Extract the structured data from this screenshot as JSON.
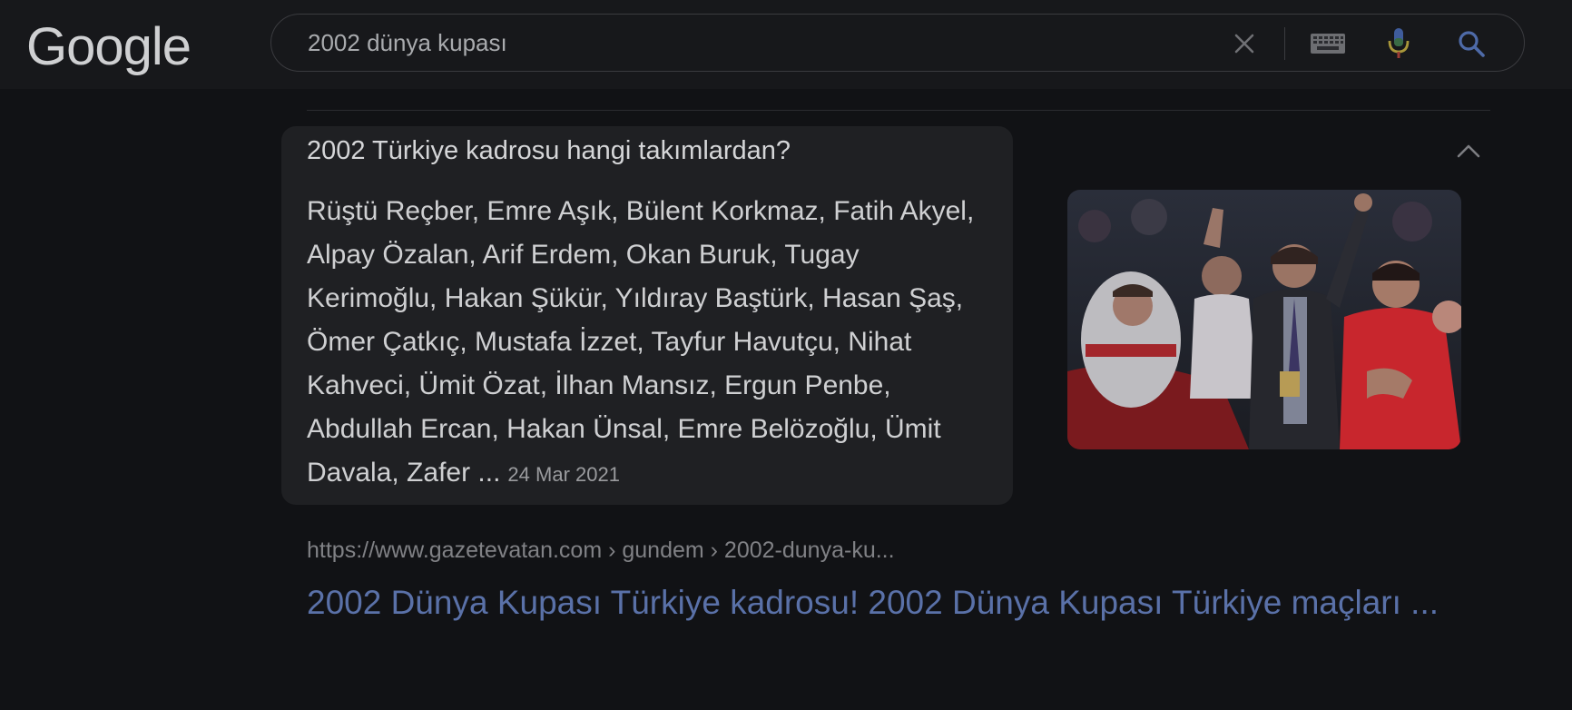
{
  "header": {
    "logo_text": "Google",
    "search": {
      "query": "2002 dünya kupası"
    },
    "icons": {
      "clear": "close-icon",
      "keyboard": "keyboard-icon",
      "mic": "microphone-icon",
      "search": "search-icon"
    }
  },
  "featured_snippet": {
    "question": "2002 Türkiye kadrosu hangi takımlardan?",
    "answer": "Rüştü Reçber, Emre Aşık, Bülent Korkmaz, Fatih Akyel, Alpay Özalan, Arif Erdem, Okan Buruk, Tugay Kerimoğlu, Hakan Şükür, Yıldıray Baştürk, Hasan Şaş, Ömer Çatkıç, Mustafa İzzet, Tayfur Havutçu, Nihat Kahveci, Ümit Özat, İlhan Mansız, Ergun Penbe, Abdullah Ercan, Hakan Ünsal, Emre Belözoğlu, Ümit Davala, Zafer ...",
    "date": "24 Mar 2021",
    "collapse_icon": "chevron-up-icon",
    "image_icon": "team-photo-image"
  },
  "result": {
    "cite": "https://www.gazetevatan.com › gundem › 2002-dunya-ku...",
    "title": "2002 Dünya Kupası Türkiye kadrosu! 2002 Dünya Kupası Türkiye maçları ..."
  },
  "colors": {
    "background": "#111215",
    "header_bg": "#17181b",
    "card_bg": "#1f2023",
    "link": "#5a71a8",
    "text": "#cfd0d2"
  }
}
